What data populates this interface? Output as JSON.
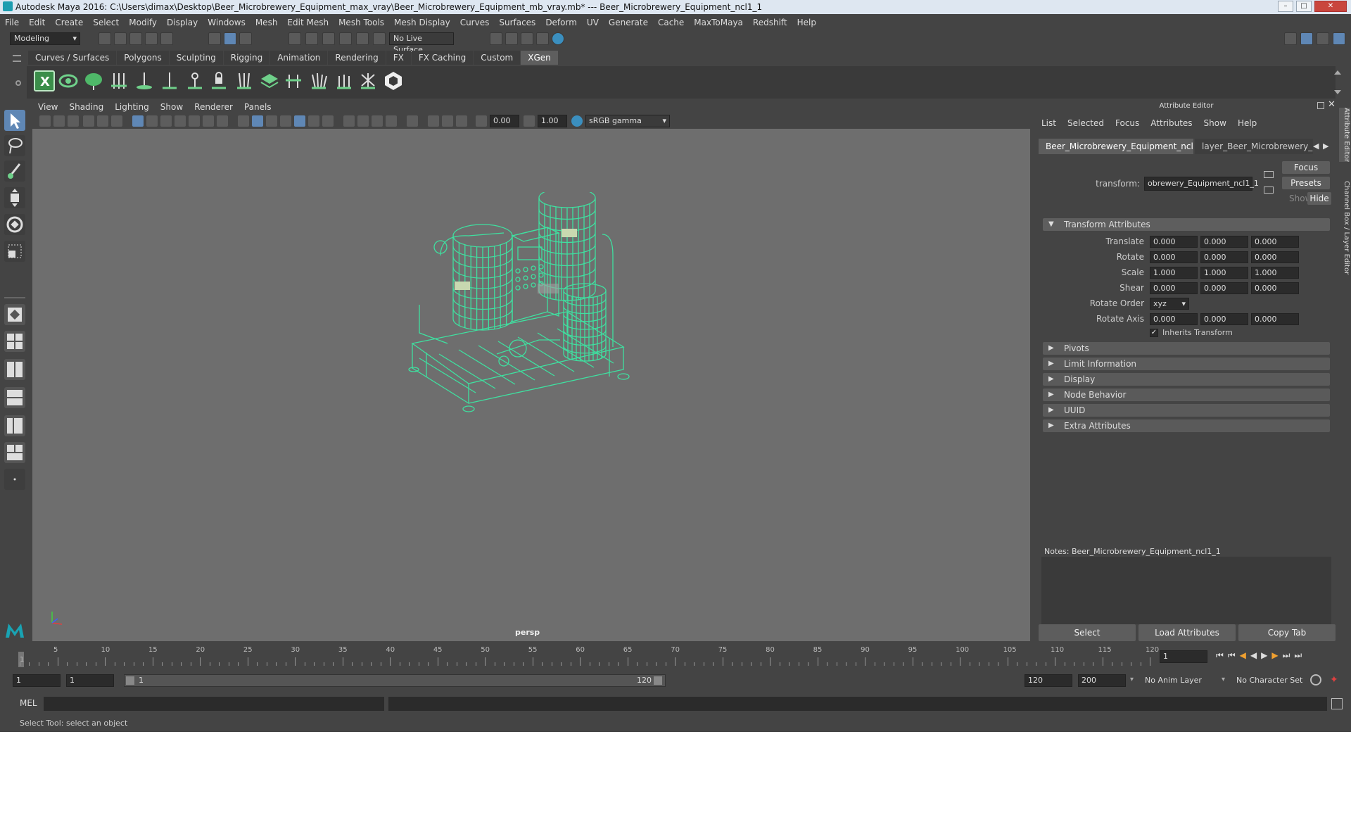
{
  "window": {
    "title": "Autodesk Maya 2016: C:\\Users\\dimax\\Desktop\\Beer_Microbrewery_Equipment_max_vray\\Beer_Microbrewery_Equipment_mb_vray.mb*   ---   Beer_Microbrewery_Equipment_ncl1_1"
  },
  "menubar": [
    "File",
    "Edit",
    "Create",
    "Select",
    "Modify",
    "Display",
    "Windows",
    "Mesh",
    "Edit Mesh",
    "Mesh Tools",
    "Mesh Display",
    "Curves",
    "Surfaces",
    "Deform",
    "UV",
    "Generate",
    "Cache",
    "MaxToMaya",
    "Redshift",
    "Help"
  ],
  "statusline": {
    "mode": "Modeling",
    "live_surface": "No Live Surface"
  },
  "shelf": {
    "tabs": [
      "Curves / Surfaces",
      "Polygons",
      "Sculpting",
      "Rigging",
      "Animation",
      "Rendering",
      "FX",
      "FX Caching",
      "Custom",
      "XGen"
    ],
    "active_tab": "XGen",
    "icons": [
      "xgen-x-icon",
      "xgen-eye-icon",
      "xgen-leaf-icon",
      "xgen-add-guide-icon",
      "xgen-place-icon",
      "xgen-guide-icon",
      "xgen-sculpt-icon",
      "xgen-lock-icon",
      "xgen-rebuild-icon",
      "xgen-layer-icon",
      "xgen-cut-icon",
      "xgen-comb-icon",
      "xgen-length-icon",
      "xgen-noise-icon",
      "xgen-hex-icon"
    ]
  },
  "viewport": {
    "menu": [
      "View",
      "Shading",
      "Lighting",
      "Show",
      "Renderer",
      "Panels"
    ],
    "exposure": "0.00",
    "gamma": "1.00",
    "color_space": "sRGB gamma",
    "camera_label": "persp",
    "wire_color": "#3fe0a0"
  },
  "attribute_editor": {
    "title": "Attribute Editor",
    "menu": [
      "List",
      "Selected",
      "Focus",
      "Attributes",
      "Show",
      "Help"
    ],
    "tabs": [
      "Beer_Microbrewery_Equipment_ncl1_1",
      "layer_Beer_Microbrewery_Equ"
    ],
    "transform_label": "transform:",
    "transform_value": "obrewery_Equipment_ncl1_1",
    "focus_btn": "Focus",
    "presets_btn": "Presets",
    "show_btn": "Show",
    "hide_btn": "Hide",
    "section_transform": "Transform Attributes",
    "rows": [
      {
        "label": "Translate",
        "v": [
          "0.000",
          "0.000",
          "0.000"
        ]
      },
      {
        "label": "Rotate",
        "v": [
          "0.000",
          "0.000",
          "0.000"
        ]
      },
      {
        "label": "Scale",
        "v": [
          "1.000",
          "1.000",
          "1.000"
        ]
      },
      {
        "label": "Shear",
        "v": [
          "0.000",
          "0.000",
          "0.000"
        ]
      }
    ],
    "rotate_order_label": "Rotate Order",
    "rotate_order_value": "xyz",
    "rotate_axis_label": "Rotate Axis",
    "rotate_axis": [
      "0.000",
      "0.000",
      "0.000"
    ],
    "inherits_label": "Inherits Transform",
    "sections": [
      "Pivots",
      "Limit Information",
      "Display",
      "Node Behavior",
      "UUID",
      "Extra Attributes"
    ],
    "notes_label": "Notes:  Beer_Microbrewery_Equipment_ncl1_1",
    "bottom_buttons": [
      "Select",
      "Load Attributes",
      "Copy Tab"
    ]
  },
  "side_tabs": [
    "Attribute Editor",
    "Channel Box / Layer Editor"
  ],
  "timeline": {
    "ticks": [
      "5",
      "10",
      "15",
      "20",
      "25",
      "30",
      "35",
      "40",
      "45",
      "50",
      "55",
      "60",
      "65",
      "70",
      "75",
      "80",
      "85",
      "90",
      "95",
      "100",
      "105",
      "110",
      "115",
      "120"
    ],
    "start_mark": "1",
    "current_frame": "1"
  },
  "range": {
    "start": "1",
    "playback_start": "1",
    "slider_start": "1",
    "slider_end": "120",
    "playback_end": "120",
    "end": "200",
    "anim_layer": "No Anim Layer",
    "char_set": "No Character Set"
  },
  "mel": {
    "label": "MEL"
  },
  "help_line": "Select Tool: select an object"
}
